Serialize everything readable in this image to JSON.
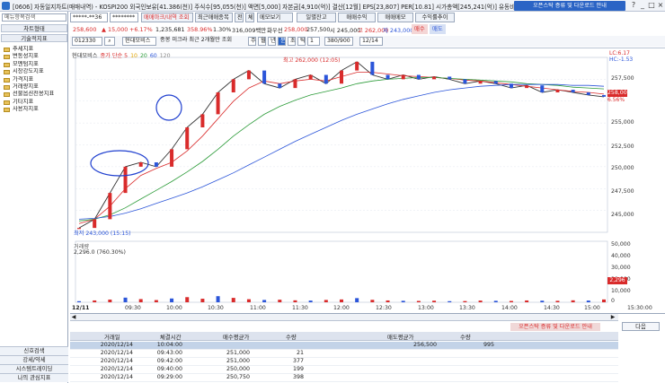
{
  "window": {
    "title": "[0606] 자동일지차트(매매내역) - KOSPI200 외국인보유[41.386(천)] 주식수[95,055(천)] 액면[5,000] 자본금[4,910(억)] 결산[12월] EPS[23,807] PER[10.81] 시가총액[245,241(억)] 유동비율[66.2]",
    "notice": "오픈스탁 증류 및 다운로드 안내",
    "buttons": [
      "?",
      "_",
      "□",
      "×"
    ]
  },
  "left": {
    "search": "메뉴항목검색",
    "tab1": "차트형태",
    "tab2": "기술적지표",
    "items": [
      "추세지표",
      "변동성지표",
      "모멘텀지표",
      "시장강도지표",
      "가격지표",
      "거래량지표",
      "선물옵션전용지표",
      "기타지표",
      "사용자지표"
    ],
    "bottom": [
      "신호검색",
      "강세/약세",
      "시스템트레이딩",
      "나의 관심지표"
    ]
  },
  "toolbar1": {
    "account": "*****-**36",
    "password": "********",
    "btn_trades": "매매마크/내역 조회",
    "btn_recent": "최근매매종목",
    "btn_ten": "전",
    "btn_next": "체",
    "btn_memo": "메모보기",
    "btn_daily": "일별잔고",
    "btn_profit": "매매수익",
    "btn_memo2": "매매메모",
    "btn_rate": "수익률추이"
  },
  "info": {
    "price": "258,600",
    "arrow": "▲",
    "change": "15,000",
    "pct": "+6.17%",
    "volume": "1,235,681",
    "vol_pct": "358.96%",
    "turnover": "1.30%",
    "amount": "316,009백만",
    "open_label": "화우선",
    "open": "258,000",
    "high_label": "257,500",
    "low_label": "시 245,000",
    "hi": "고 262,000",
    "lo": "저 243,000",
    "btn_sell": "매수",
    "btn_buy": "매도"
  },
  "toolbar3": {
    "code": "012330",
    "name": "현대모비스",
    "check1": "종봉 미크라 최근 2개월만 조회",
    "period": [
      "주",
      "월",
      "년",
      "분",
      "초",
      "틱"
    ],
    "interval": "1",
    "count": "380/900",
    "date": "12/14"
  },
  "chart": {
    "legend": [
      {
        "name": "현대모비스",
        "color": "#333333"
      },
      {
        "name": "종가 단순 5",
        "color": "#d92b2b"
      },
      {
        "name": "10",
        "color": "#e1a300"
      },
      {
        "name": "20",
        "color": "#2b9b38"
      },
      {
        "name": "60",
        "color": "#2b55d9"
      },
      {
        "name": "120",
        "color": "#888888"
      }
    ],
    "hi_label": "최고 262,000 (12:05)",
    "lo_label": "최저 243,000 (15:15)",
    "lc": "LC:6.17",
    "hc": "HC:-1.53",
    "cur_price": "258,000",
    "cur_pct": "6.56%",
    "yticks": [
      "257,500",
      "255,000",
      "252,500",
      "250,000",
      "247,500",
      "245,000"
    ],
    "vol_title": "거래량",
    "vol_sub": "2,296.0 (760.30%)",
    "vol_ticks": [
      "50,000",
      "40,000",
      "30,000",
      "20,000",
      "10,000",
      "0"
    ],
    "vol_cur": "2,296",
    "date": "12/11",
    "xticks": [
      "09:30",
      "10:00",
      "10:30",
      "11:00",
      "11:30",
      "12:00",
      "12:30",
      "13:00",
      "13:30",
      "14:00",
      "14:30",
      "15:00",
      "15:30:00"
    ]
  },
  "chart_data": {
    "type": "line",
    "title": "현대모비스",
    "ylim": [
      242500,
      262500
    ],
    "series": [
      {
        "name": "현대모비스",
        "values": [
          243000,
          244000,
          247000,
          250000,
          250500,
          250000,
          252000,
          254500,
          256000,
          258500,
          260000,
          261000,
          259500,
          259000,
          260000,
          260500,
          259500,
          261000,
          262000,
          260500,
          260000,
          260500,
          260000,
          260300,
          260000,
          259500,
          259800,
          259500,
          259000,
          259300,
          258500,
          258800,
          258500,
          258200,
          258000
        ]
      },
      {
        "name": "종가 단순 5",
        "values": [
          243500,
          244000,
          245500,
          247500,
          249000,
          249800,
          250500,
          251800,
          253500,
          255500,
          257500,
          259000,
          259800,
          259500,
          259800,
          260000,
          259800,
          260300,
          260800,
          260800,
          260600,
          260400,
          260300,
          260200,
          260100,
          259900,
          259800,
          259600,
          259400,
          259200,
          259000,
          258800,
          258600,
          258500,
          258300
        ]
      },
      {
        "name": "20",
        "values": [
          243800,
          244000,
          244500,
          245300,
          246300,
          247300,
          248300,
          249400,
          250600,
          252000,
          253500,
          254800,
          256000,
          256900,
          257600,
          258200,
          258600,
          259000,
          259500,
          259800,
          260000,
          260100,
          260200,
          260200,
          260100,
          260000,
          259900,
          259800,
          259700,
          259500,
          259400,
          259300,
          259100,
          259000,
          258900
        ]
      },
      {
        "name": "60",
        "values": [
          244000,
          244100,
          244300,
          244700,
          245200,
          245800,
          246400,
          247000,
          247700,
          248500,
          249300,
          250200,
          251100,
          252000,
          252900,
          253700,
          254500,
          255300,
          256000,
          256600,
          257200,
          257700,
          258100,
          258500,
          258800,
          259000,
          259200,
          259300,
          259400,
          259400,
          259400,
          259400,
          259300,
          259300,
          259200
        ]
      }
    ],
    "volume": [
      900,
      1500,
      2200,
      3800,
      2600,
      1800,
      3100,
      4200,
      2900,
      5000,
      3600,
      2500,
      1900,
      2100,
      1600,
      1400,
      1900,
      2300,
      3400,
      2000,
      1500,
      1200,
      1100,
      1300,
      900,
      1000,
      1400,
      1200,
      1100,
      1500,
      1300,
      1200,
      1600,
      1400,
      2296
    ]
  },
  "bottom": {
    "notice": "오픈스탁 증류 및 다운로드 안내",
    "next": "다음",
    "headers": [
      "거래일",
      "체결시간",
      "매수평균가",
      "수량",
      "매도평균가",
      "수량"
    ],
    "rows": [
      [
        "2020/12/14",
        "10:04:00",
        "",
        "",
        "256,500",
        "995"
      ],
      [
        "2020/12/14",
        "09:43:00",
        "251,000",
        "21",
        "",
        ""
      ],
      [
        "2020/12/14",
        "09:42:00",
        "251,000",
        "377",
        "",
        ""
      ],
      [
        "2020/12/14",
        "09:40:00",
        "250,000",
        "199",
        "",
        ""
      ],
      [
        "2020/12/14",
        "09:29:00",
        "250,750",
        "398",
        "",
        ""
      ]
    ]
  }
}
